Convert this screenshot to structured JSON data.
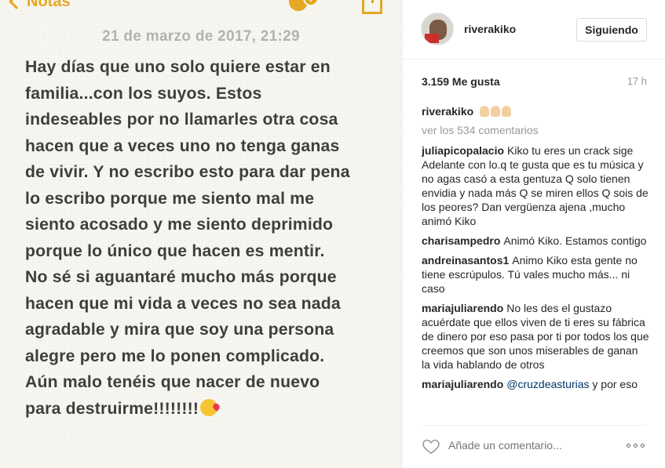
{
  "notes": {
    "back_label": "Notas",
    "date": "21 de marzo de 2017, 21:29",
    "lines": [
      "Hay días que uno solo quiere estar en",
      "familia...con los suyos. Estos",
      "indeseables por no llamarles otra cosa",
      "hacen que a veces uno no tenga ganas",
      "de vivir. Y no escribo esto para dar pena",
      "lo escribo porque me siento mal me",
      "siento acosado y me siento deprimido",
      "porque lo único que hacen es mentir.",
      "No sé si aguantaré mucho más porque",
      "hacen que mi vida a veces no sea nada",
      "agradable y mira que soy una persona",
      "alegre pero me lo ponen complicado.",
      "Aún malo tenéis que nacer de nuevo",
      "para destruirme!!!!!!!!"
    ],
    "accent_color": "#e5a823"
  },
  "post": {
    "username": "riverakiko",
    "follow_label": "Siguiendo",
    "likes": "3.159 Me gusta",
    "time_ago": "17 h",
    "caption_user": "riverakiko",
    "view_all": "ver los 534 comentarios",
    "comments": [
      {
        "user": "juliapicopalacio",
        "text": "Kiko tu eres un crack sige Adelante con lo.q te gusta que es tu música y no agas casó a esta gentuza Q solo tienen envidia y nada más Q se miren ellos Q sois de los peores? Dan vergüenza ajena ,mucho animó Kiko"
      },
      {
        "user": "charisampedro",
        "text": "Animó Kiko. Estamos contigo"
      },
      {
        "user": "andreinasantos1",
        "text": "Animo Kiko esta gente no tiene escrúpulos. Tú vales mucho más... ni caso"
      },
      {
        "user": "mariajuliarendo",
        "text": "No les des el gustazo acuérdate que ellos viven de ti eres su fábrica de dinero por eso pasa por ti por todos los que creemos que son unos miserables de ganan la vida hablando de otros"
      }
    ],
    "last_comment": {
      "user": "mariajuliarendo",
      "mention": "@cruzdeasturias",
      "text": "y por eso"
    },
    "comment_placeholder": "Añade un comentario...",
    "icons": {
      "like": "heart-icon",
      "more": "more-options-icon"
    }
  }
}
